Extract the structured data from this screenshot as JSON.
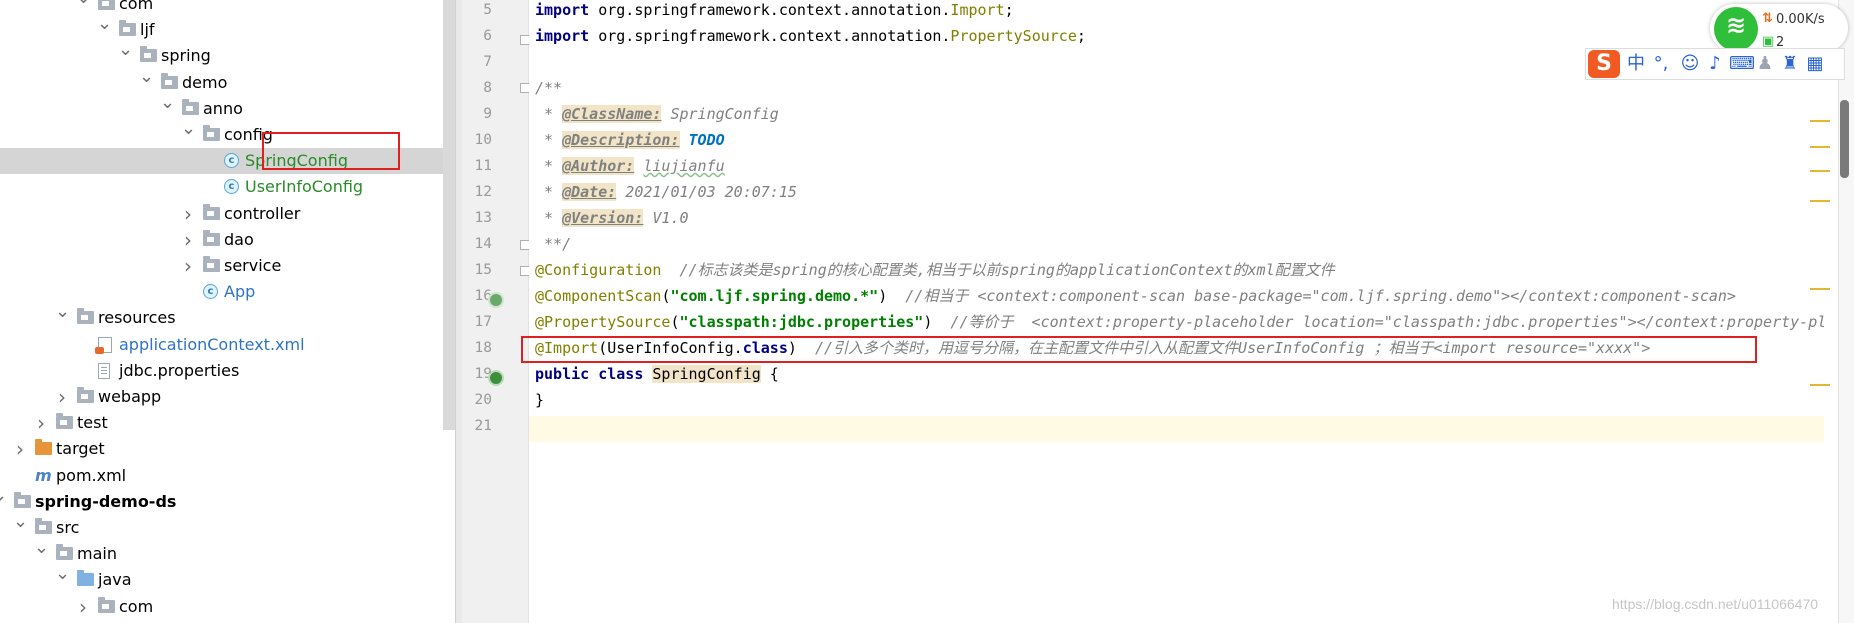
{
  "project_tree": {
    "items": [
      {
        "label": "com",
        "depth": 4,
        "kind": "package",
        "expanded": true
      },
      {
        "label": "ljf",
        "depth": 5,
        "kind": "package",
        "expanded": true
      },
      {
        "label": "spring",
        "depth": 6,
        "kind": "package",
        "expanded": true
      },
      {
        "label": "demo",
        "depth": 7,
        "kind": "package",
        "expanded": true
      },
      {
        "label": "anno",
        "depth": 8,
        "kind": "package",
        "expanded": true
      },
      {
        "label": "config",
        "depth": 9,
        "kind": "package",
        "expanded": true
      },
      {
        "label": "SpringConfig",
        "depth": 10,
        "kind": "class",
        "selected": true
      },
      {
        "label": "UserInfoConfig",
        "depth": 10,
        "kind": "class"
      },
      {
        "label": "controller",
        "depth": 9,
        "kind": "package",
        "expanded": false
      },
      {
        "label": "dao",
        "depth": 9,
        "kind": "package",
        "expanded": false
      },
      {
        "label": "service",
        "depth": 9,
        "kind": "package",
        "expanded": false
      },
      {
        "label": "App",
        "depth": 9,
        "kind": "app-class"
      },
      {
        "label": "resources",
        "depth": 3,
        "kind": "resources",
        "expanded": true
      },
      {
        "label": "applicationContext.xml",
        "depth": 4,
        "kind": "xml"
      },
      {
        "label": "jdbc.properties",
        "depth": 4,
        "kind": "properties"
      },
      {
        "label": "webapp",
        "depth": 3,
        "kind": "folder",
        "expanded": false
      },
      {
        "label": "test",
        "depth": 2,
        "kind": "folder",
        "expanded": false
      },
      {
        "label": "target",
        "depth": 1,
        "kind": "target",
        "expanded": false
      },
      {
        "label": "pom.xml",
        "depth": 1,
        "kind": "maven"
      },
      {
        "label": "spring-demo-ds",
        "depth": 0,
        "kind": "module",
        "expanded": true
      },
      {
        "label": "src",
        "depth": 1,
        "kind": "folder",
        "expanded": true
      },
      {
        "label": "main",
        "depth": 2,
        "kind": "folder",
        "expanded": true
      },
      {
        "label": "java",
        "depth": 3,
        "kind": "source-root",
        "expanded": true
      },
      {
        "label": "com",
        "depth": 4,
        "kind": "package",
        "expanded": false
      }
    ]
  },
  "editor": {
    "line_numbers": [
      "5",
      "6",
      "7",
      "8",
      "9",
      "10",
      "11",
      "12",
      "13",
      "14",
      "15",
      "16",
      "17",
      "18",
      "19",
      "20",
      "21"
    ],
    "lines": {
      "l5": {
        "kw": "import",
        "pkg": " org.springframework.context.annotation.",
        "cls": "Import",
        "end": ";"
      },
      "l6": {
        "kw": "import",
        "pkg": " org.springframework.context.annotation.",
        "cls": "PropertySource",
        "end": ";"
      },
      "l8": "/**",
      "l9": {
        "pre": " * ",
        "tag": "@ClassName:",
        "val": " SpringConfig"
      },
      "l10": {
        "pre": " * ",
        "tag": "@Description:",
        "val": "TODO"
      },
      "l11": {
        "pre": " * ",
        "tag": "@Author:",
        "val": "liujianfu"
      },
      "l12": {
        "pre": " * ",
        "tag": "@Date:",
        "val": " 2021/01/03 20:07:15"
      },
      "l13": {
        "pre": " * ",
        "tag": "@Version:",
        "val": " V1.0"
      },
      "l14": " **/",
      "l15": {
        "ann": "@Configuration",
        "cmt": "  //标志该类是spring的核心配置类,相当于以前spring的applicationContext的xml配置文件"
      },
      "l16": {
        "ann": "@ComponentScan",
        "open": "(",
        "str": "\"com.ljf.spring.demo.*\"",
        "close": ")",
        "cmt": "  //相当于 <context:component-scan base-package=\"com.ljf.spring.demo\"></context:component-scan>"
      },
      "l17": {
        "ann": "@PropertySource",
        "open": "(",
        "str": "\"classpath:jdbc.properties\"",
        "close": ")",
        "cmt": "  //等价于  <context:property-placeholder location=\"classpath:jdbc.properties\"></context:property-placeholder>"
      },
      "l18": {
        "ann": "@Import",
        "open": "(UserInfoConfig.",
        "kw": "class",
        "close": ")",
        "cmt": "  //引入多个类时，用逗号分隔，在主配置文件中引入从配置文件UserInfoConfig ；相当于<import resource=\"xxxx\">"
      },
      "l19": {
        "kw": "public class ",
        "cls": "SpringConfig",
        "rest": " {"
      },
      "l20": "}"
    }
  },
  "system_tray": {
    "net_speed": "0.00K/s",
    "net_count": "2"
  },
  "ime_toolbar": {
    "logo": "S",
    "mode": "中",
    "punct": "°,"
  },
  "watermark": "https://blog.csdn.net/u011066470",
  "colors": {
    "highlight_box": "#e02020",
    "selection": "#d5d5d5",
    "current_line": "#fffae3"
  }
}
